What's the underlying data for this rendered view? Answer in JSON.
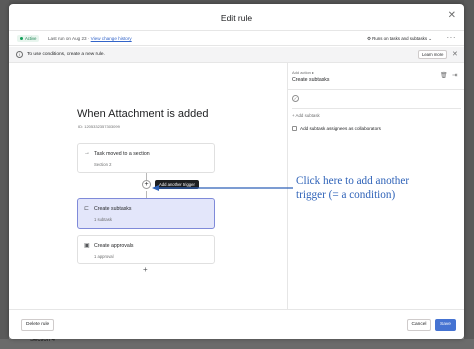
{
  "modal": {
    "title": "Edit rule",
    "close_icon": "close-icon"
  },
  "status_bar": {
    "badge": "Active",
    "last_run_prefix": "Last run on Aug 23 · ",
    "change_history_link": "View change history",
    "runs_on_label": "Runs on tasks and subtasks",
    "more_icon": "more-dots-icon"
  },
  "info_bar": {
    "text": "To use conditions, create a new rule.",
    "learn_more": "Learn more",
    "close_icon": "close-icon"
  },
  "canvas": {
    "rule_title": "When Attachment is added",
    "rule_id": "ID: 1205332357303099",
    "trigger_card": {
      "title": "Task moved to a section",
      "subtitle": "Section 2",
      "icon": "arrow-right-icon"
    },
    "tooltip": "Add another trigger",
    "action_cards": [
      {
        "title": "Create subtasks",
        "subtitle": "1 subtask",
        "icon": "subtask-icon",
        "selected": true
      },
      {
        "title": "Create approvals",
        "subtitle": "1 approval",
        "icon": "approval-icon",
        "selected": false
      }
    ]
  },
  "annotation": {
    "line1": "Click here to add another",
    "line2": "trigger (= a condition)",
    "color": "#2e62b8"
  },
  "right_panel": {
    "kicker": "Add action ▸",
    "title": "Create subtasks",
    "add_subtask": "+ Add subtask",
    "collaborators_label": "Add subtask assignees as collaborators",
    "collaborators_checked": false
  },
  "footer": {
    "delete_button": "Delete rule",
    "cancel_button": "Cancel",
    "save_button": "Save"
  },
  "background": {
    "section_peek": "Section 4"
  },
  "colors": {
    "primary": "#4573d2",
    "active_green": "#14a05a",
    "selected_card_bg": "#e3e6fa",
    "selected_card_border": "#7f8ad9"
  }
}
